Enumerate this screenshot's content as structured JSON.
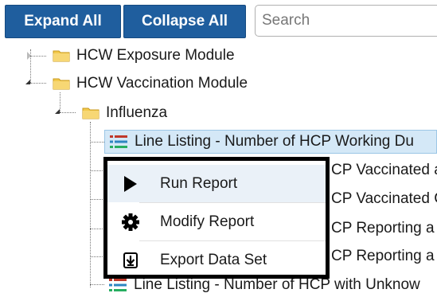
{
  "toolbar": {
    "expand_label": "Expand All",
    "collapse_label": "Collapse All",
    "search_placeholder": "Search"
  },
  "tree": {
    "nodes": [
      {
        "label": "HCW Exposure Module",
        "type": "folder",
        "expanded": false
      },
      {
        "label": "HCW Vaccination Module",
        "type": "folder",
        "expanded": true
      },
      {
        "label": "Influenza",
        "type": "folder",
        "expanded": true
      },
      {
        "label": "Line Listing - Number of HCP Working Du",
        "type": "report",
        "selected": true
      },
      {
        "label": "CP Vaccinated a",
        "type": "report"
      },
      {
        "label": "CP Vaccinated C",
        "type": "report"
      },
      {
        "label": "CP Reporting a",
        "type": "report"
      },
      {
        "label": "CP Reporting a",
        "type": "report"
      },
      {
        "label": "Line Listing - Number of HCP with Unknow",
        "type": "report"
      }
    ]
  },
  "context_menu": {
    "items": [
      {
        "label": "Run Report",
        "icon": "play-icon"
      },
      {
        "label": "Modify Report",
        "icon": "gear-icon"
      },
      {
        "label": "Export Data Set",
        "icon": "export-icon"
      }
    ]
  },
  "colors": {
    "button_bg": "#1f5e9e",
    "selection_bg": "#d4e8f7",
    "folder": "#f2c94c",
    "menu_border": "#000000"
  }
}
